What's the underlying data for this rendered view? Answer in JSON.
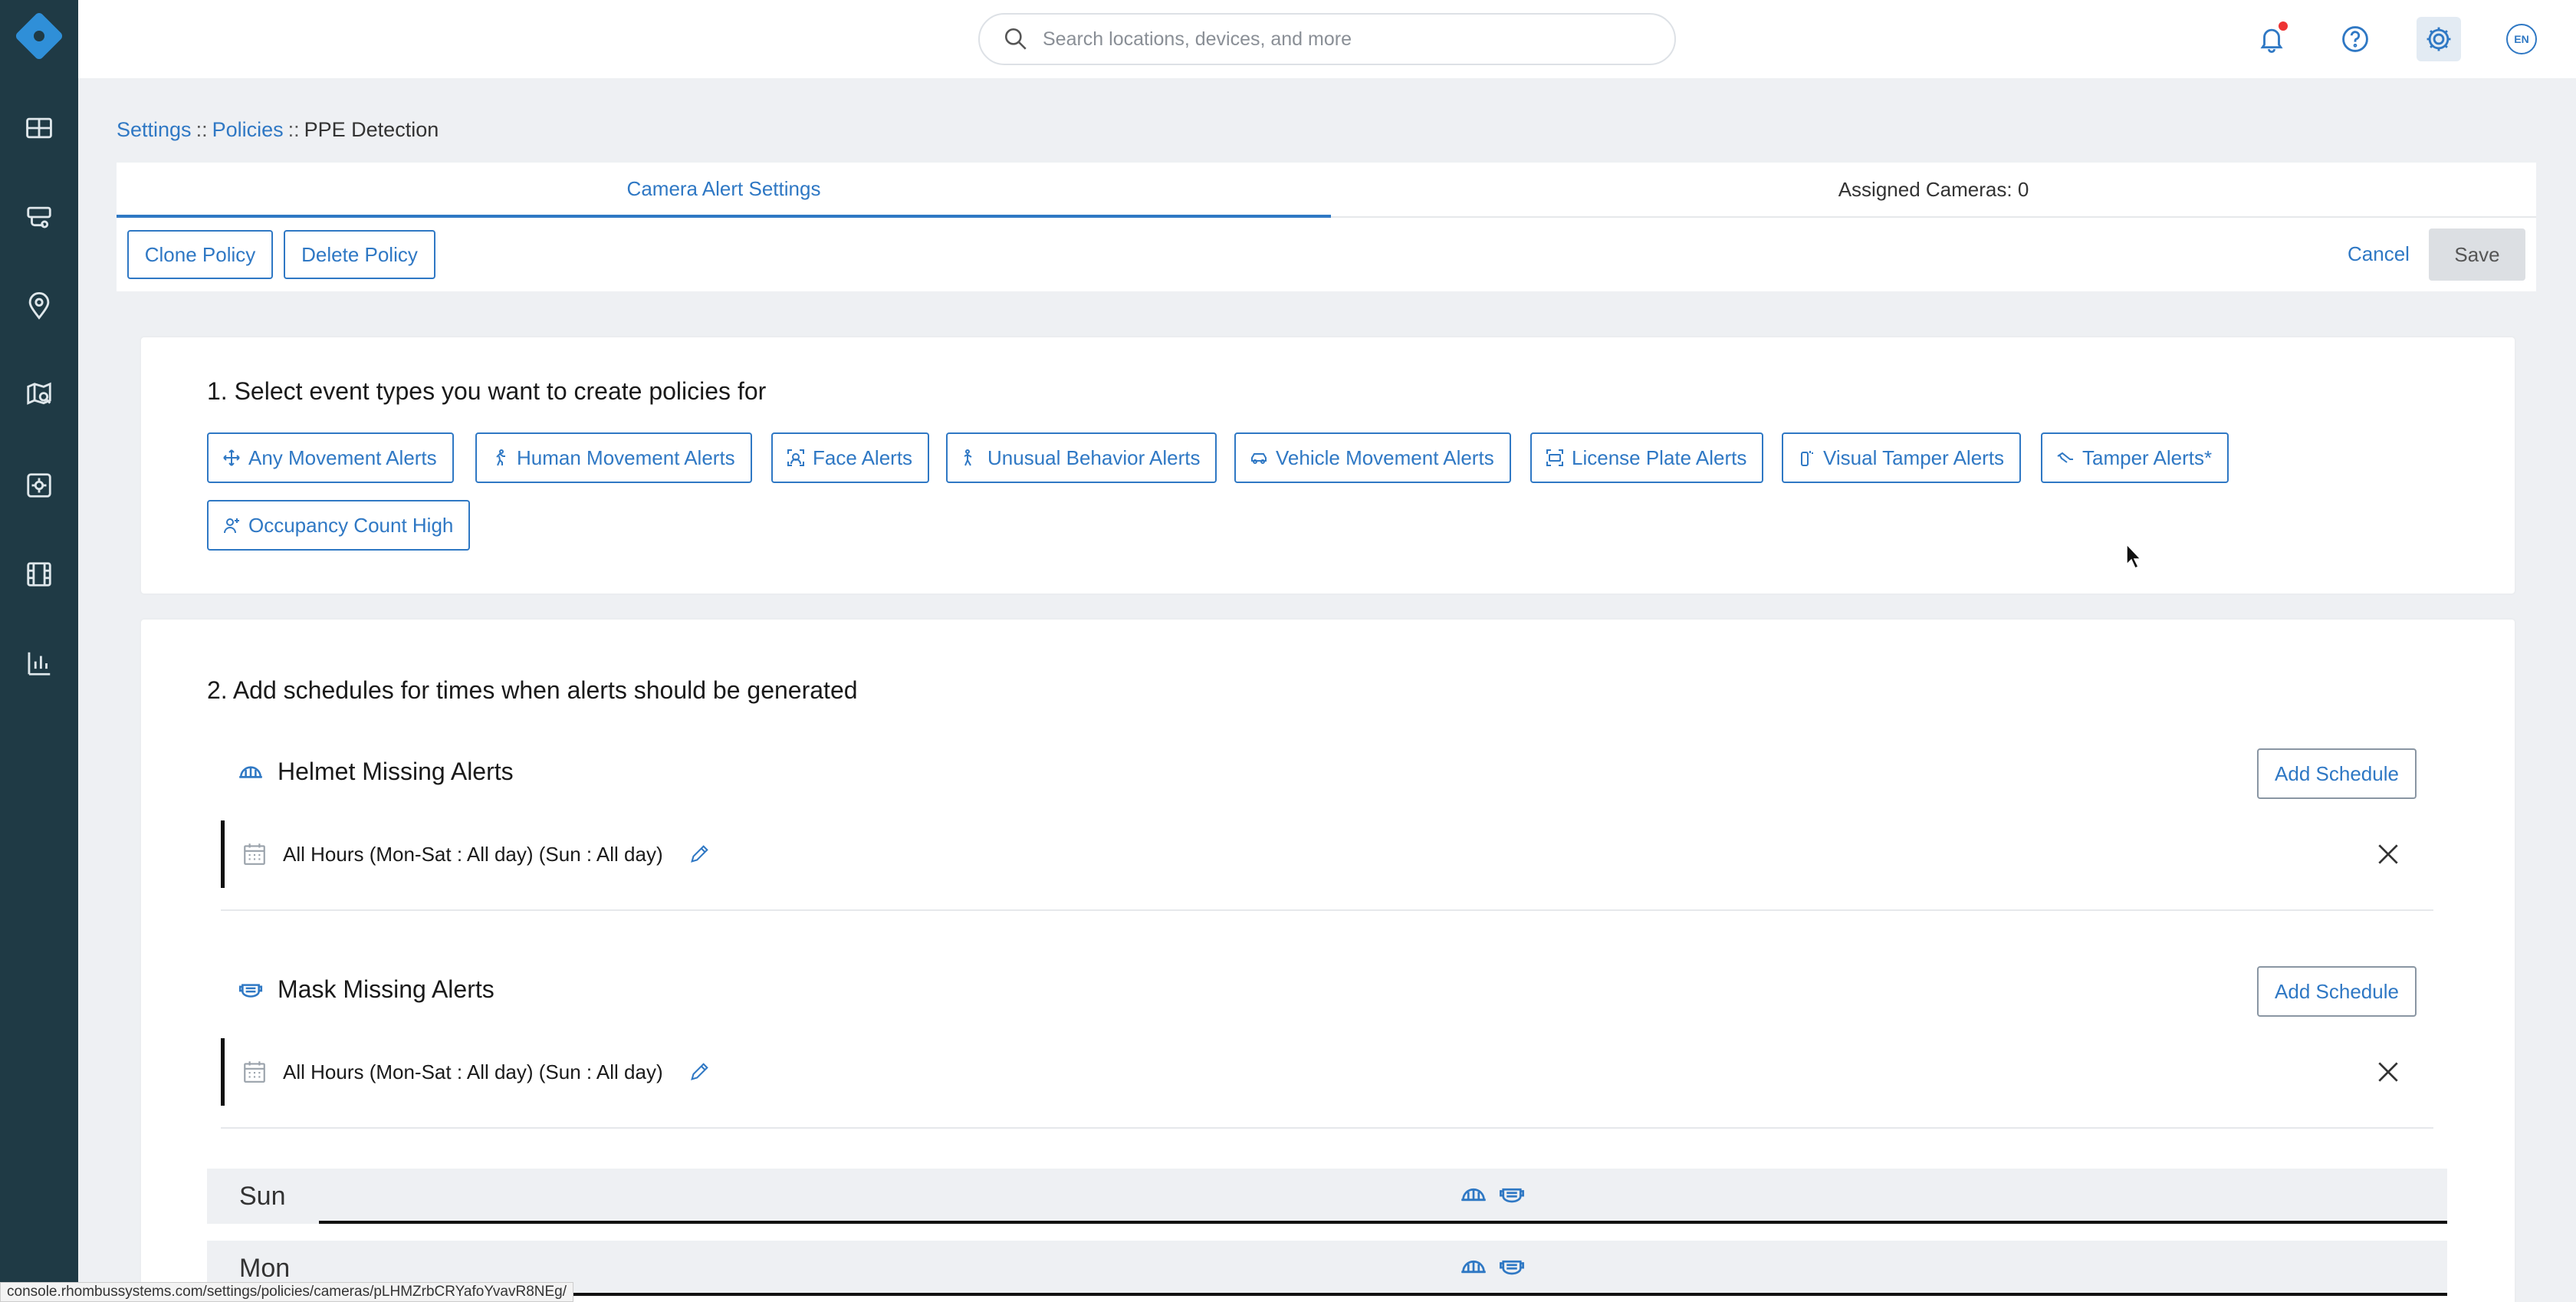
{
  "search": {
    "placeholder": "Search locations, devices, and more"
  },
  "topbar": {
    "language": "EN"
  },
  "sidebar": {
    "items": [
      {
        "name": "dashboard-icon"
      },
      {
        "name": "cameras-icon"
      },
      {
        "name": "locations-icon"
      },
      {
        "name": "map-icon"
      },
      {
        "name": "integrations-icon"
      },
      {
        "name": "video-icon"
      },
      {
        "name": "reports-icon"
      }
    ]
  },
  "breadcrumb": {
    "settings": "Settings",
    "policies": "Policies",
    "current": "PPE Detection",
    "separator": "::"
  },
  "tabs": {
    "alert_settings": "Camera Alert Settings",
    "assigned_cameras": "Assigned Cameras: 0"
  },
  "actions": {
    "clone": "Clone Policy",
    "delete": "Delete Policy",
    "cancel": "Cancel",
    "save": "Save"
  },
  "section1": {
    "title": "1. Select event types you want to create policies for",
    "chips": [
      "Any Movement Alerts",
      "Human Movement Alerts",
      "Face Alerts",
      "Unusual Behavior Alerts",
      "Vehicle Movement Alerts",
      "License Plate Alerts",
      "Visual Tamper Alerts",
      "Tamper Alerts*",
      "Occupancy Count High"
    ]
  },
  "section2": {
    "title": "2. Add schedules for times when alerts should be generated",
    "add_schedule": "Add Schedule",
    "alerts": [
      {
        "name": "Helmet Missing Alerts",
        "schedule": "All Hours (Mon-Sat : All day) (Sun : All day)"
      },
      {
        "name": "Mask Missing Alerts",
        "schedule": "All Hours (Mon-Sat : All day) (Sun : All day)"
      }
    ],
    "days": [
      "Sun",
      "Mon"
    ]
  },
  "status_url": "console.rhombussystems.com/settings/policies/cameras/pLHMZrbCRYafoYvavR8NEg/",
  "colors": {
    "accent": "#2f78c4",
    "sidebar": "#1f3a45",
    "logo": "#2f8fd8"
  }
}
